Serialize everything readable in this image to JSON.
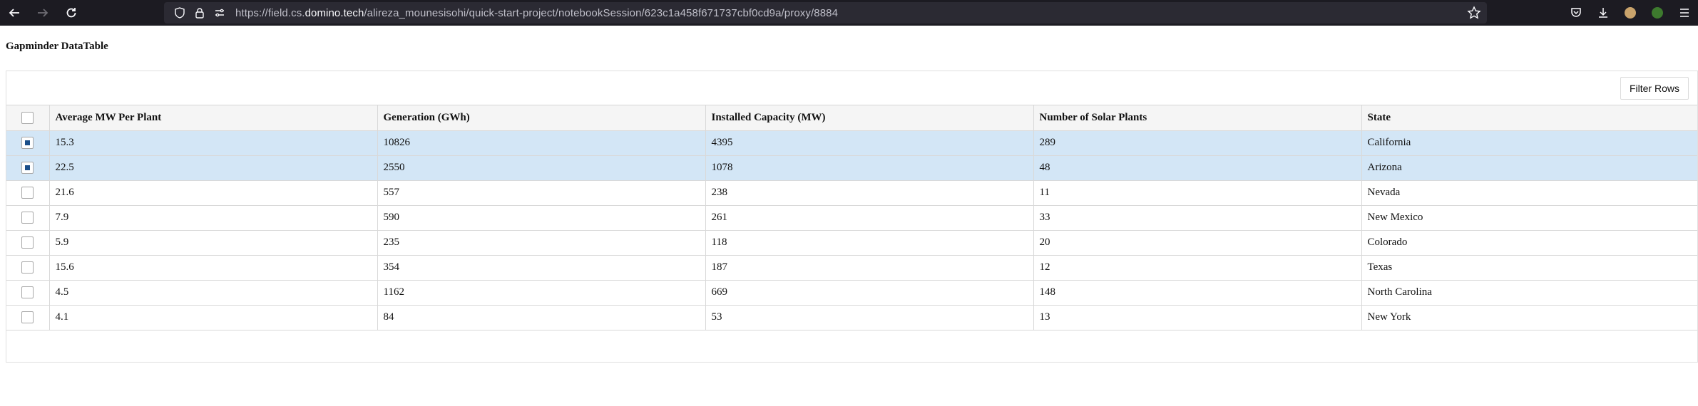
{
  "browser": {
    "url_prefix": "https://field.cs.",
    "url_domain": "domino.tech",
    "url_path": "/alireza_mounesisohi/quick-start-project/notebookSession/623c1a458f671737cbf0cd9a/proxy/8884"
  },
  "page": {
    "title": "Gapminder DataTable",
    "filter_button": "Filter Rows"
  },
  "table": {
    "columns": [
      "Average MW Per Plant",
      "Generation (GWh)",
      "Installed Capacity (MW)",
      "Number of Solar Plants",
      "State"
    ],
    "rows": [
      {
        "selected": true,
        "cells": [
          "15.3",
          "10826",
          "4395",
          "289",
          "California"
        ]
      },
      {
        "selected": true,
        "cells": [
          "22.5",
          "2550",
          "1078",
          "48",
          "Arizona"
        ]
      },
      {
        "selected": false,
        "cells": [
          "21.6",
          "557",
          "238",
          "11",
          "Nevada"
        ]
      },
      {
        "selected": false,
        "cells": [
          "7.9",
          "590",
          "261",
          "33",
          "New Mexico"
        ]
      },
      {
        "selected": false,
        "cells": [
          "5.9",
          "235",
          "118",
          "20",
          "Colorado"
        ]
      },
      {
        "selected": false,
        "cells": [
          "15.6",
          "354",
          "187",
          "12",
          "Texas"
        ]
      },
      {
        "selected": false,
        "cells": [
          "4.5",
          "1162",
          "669",
          "148",
          "North Carolina"
        ]
      },
      {
        "selected": false,
        "cells": [
          "4.1",
          "84",
          "53",
          "13",
          "New York"
        ]
      }
    ]
  },
  "colors": {
    "selected_row": "#d3e6f6",
    "header_bg": "#f5f5f5",
    "checkbox_fill": "#1b4f8a"
  }
}
